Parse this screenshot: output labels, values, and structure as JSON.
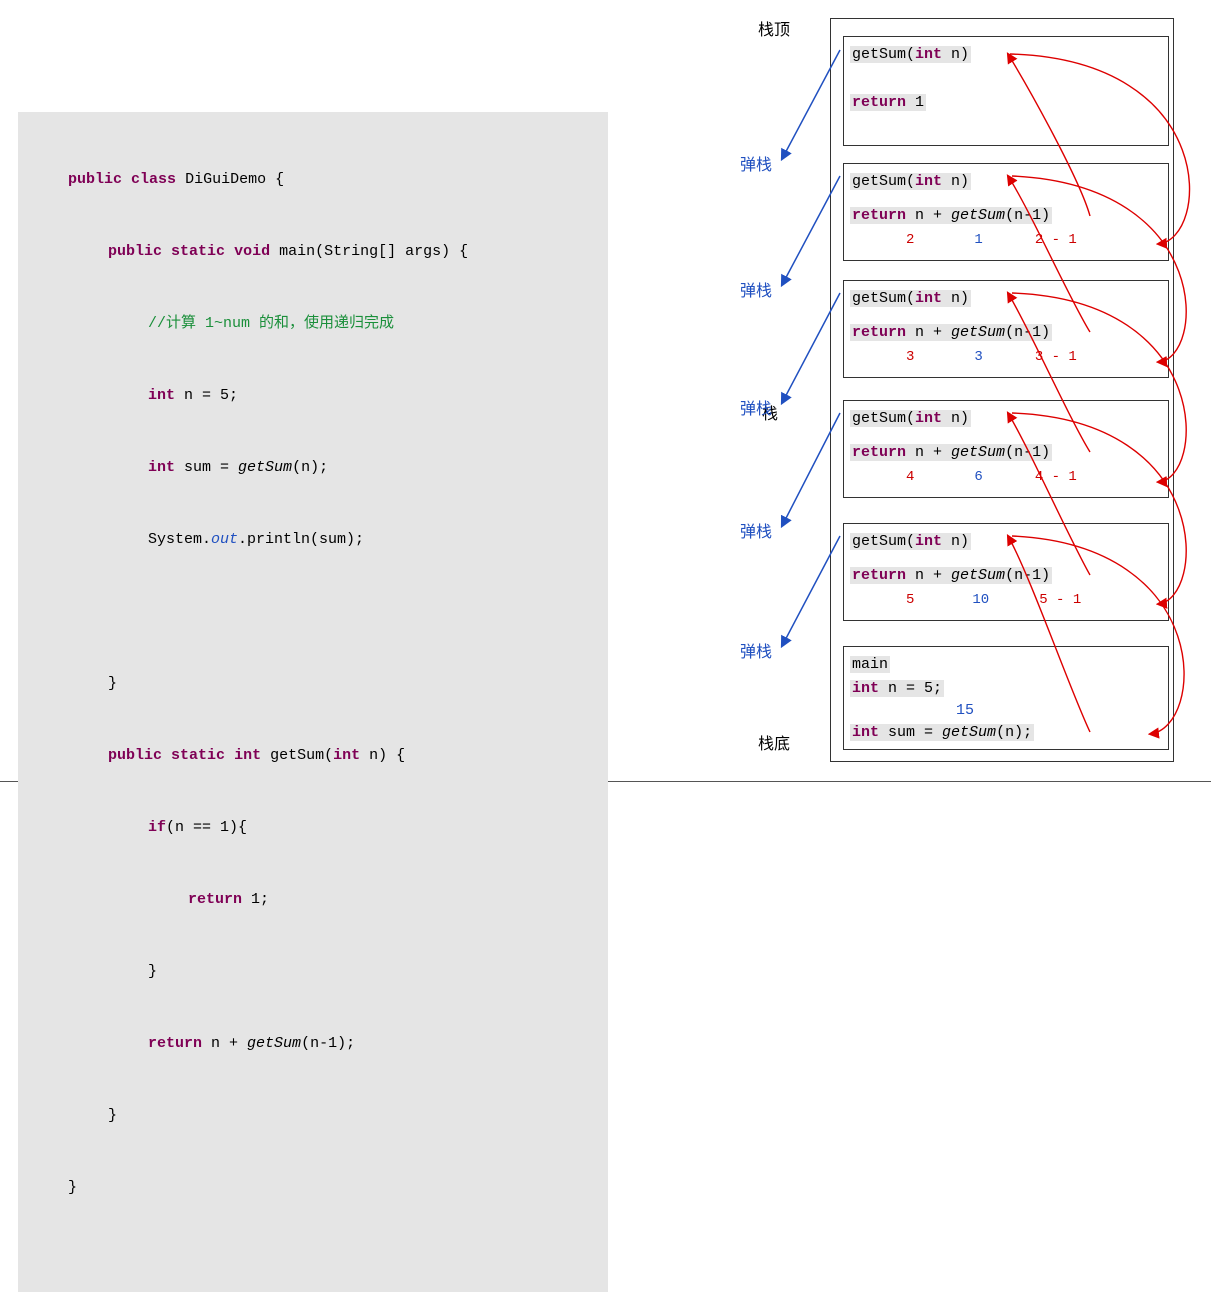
{
  "code": {
    "l1a": "public",
    "l1b": "class",
    "l1c": "DiGuiDemo {",
    "l2a": "public",
    "l2b": "static",
    "l2c": "void",
    "l2d": "main(String[] args) {",
    "l3": "//计算 1~num 的和，使用递归完成",
    "l4a": "int",
    "l4b": "n = 5;",
    "l5a": "int",
    "l5b": "sum = ",
    "l5c": "getSum",
    "l5d": "(n);",
    "l6a": "System.",
    "l6b": "out",
    "l6c": ".println(sum);",
    "l7": "}",
    "l8a": "public",
    "l8b": "static",
    "l8c": "int",
    "l8d": "getSum(",
    "l8e": "int",
    "l8f": "n) {",
    "l9a": "if",
    "l9b": "(n == 1){",
    "l10a": "return",
    "l10b": "1;",
    "l11": "}",
    "l12a": "return",
    "l12b": "n + ",
    "l12c": "getSum",
    "l12d": "(n-1);",
    "l13": "}",
    "l14": "}"
  },
  "labels": {
    "top": "栈顶",
    "mid": "栈",
    "bottom": "栈底",
    "pop": "弹栈"
  },
  "frames": [
    {
      "title_a": "getSum(",
      "title_b": "int",
      "title_c": " n)",
      "ret_a": "return",
      "ret_b": "1"
    },
    {
      "title_a": "getSum(",
      "title_b": "int",
      "title_c": " n)",
      "ret_a": "return",
      "ret_b": "n + ",
      "ret_c": "getSum",
      "ret_d": "(n-1)",
      "v1": "2",
      "v2": "1",
      "v3": "2 - 1"
    },
    {
      "title_a": "getSum(",
      "title_b": "int",
      "title_b2": " n)",
      "ret_a": "return",
      "ret_b": "n + ",
      "ret_c": "getSum",
      "ret_d": "(n-1)",
      "v1": "3",
      "v2": "3",
      "v3": "3 - 1"
    },
    {
      "title_a": "getSum(",
      "title_b": "int",
      "title_b2": " n)",
      "ret_a": "return",
      "ret_b": "n + ",
      "ret_c": "getSum",
      "ret_d": "(n-1)",
      "v1": "4",
      "v2": "6",
      "v3": "4 - 1"
    },
    {
      "title_a": "getSum(",
      "title_b": "int",
      "title_b2": " n)",
      "ret_a": "return",
      "ret_b": "n + ",
      "ret_c": "getSum",
      "ret_d": "(n-1)",
      "v1": "5",
      "v2": "10",
      "v3": "5 - 1"
    }
  ],
  "main_frame": {
    "title": "main",
    "l1a": "int",
    "l1b": "n = 5;",
    "result": "15",
    "l2a": "int",
    "l2b": "sum = ",
    "l2c": "getSum",
    "l2d": "(n);"
  }
}
